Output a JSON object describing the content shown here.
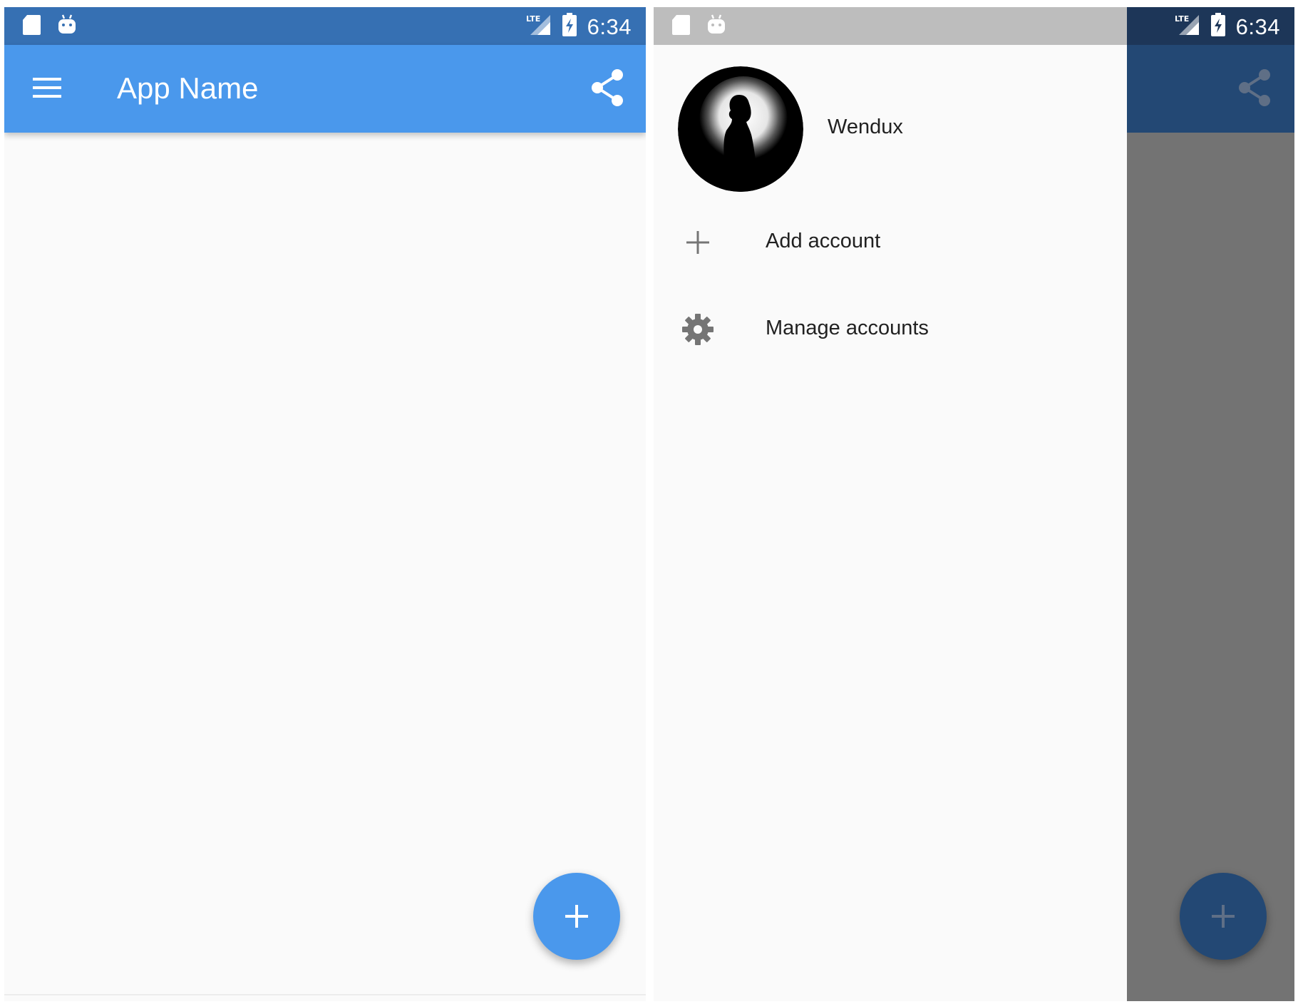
{
  "colors": {
    "primary": "#4a98ec",
    "primary_dark": "#3670b3",
    "background": "#fafafa",
    "scrim": "#737373",
    "drawer_status": "#bdbdbd",
    "text_primary": "#212121",
    "icon_grey": "#757575"
  },
  "status_bar": {
    "time": "6:34",
    "icons": [
      "sd-card-icon",
      "android-icon",
      "lte-signal-icon",
      "battery-charging-icon"
    ]
  },
  "main_screen": {
    "app_title": "App Name",
    "menu_icon": "menu-icon",
    "share_icon": "share-icon",
    "fab_icon": "plus-icon"
  },
  "drawer_screen": {
    "account": {
      "name": "Wendux"
    },
    "items": [
      {
        "icon": "plus-icon",
        "label": "Add account"
      },
      {
        "icon": "gear-icon",
        "label": "Manage accounts"
      }
    ]
  }
}
